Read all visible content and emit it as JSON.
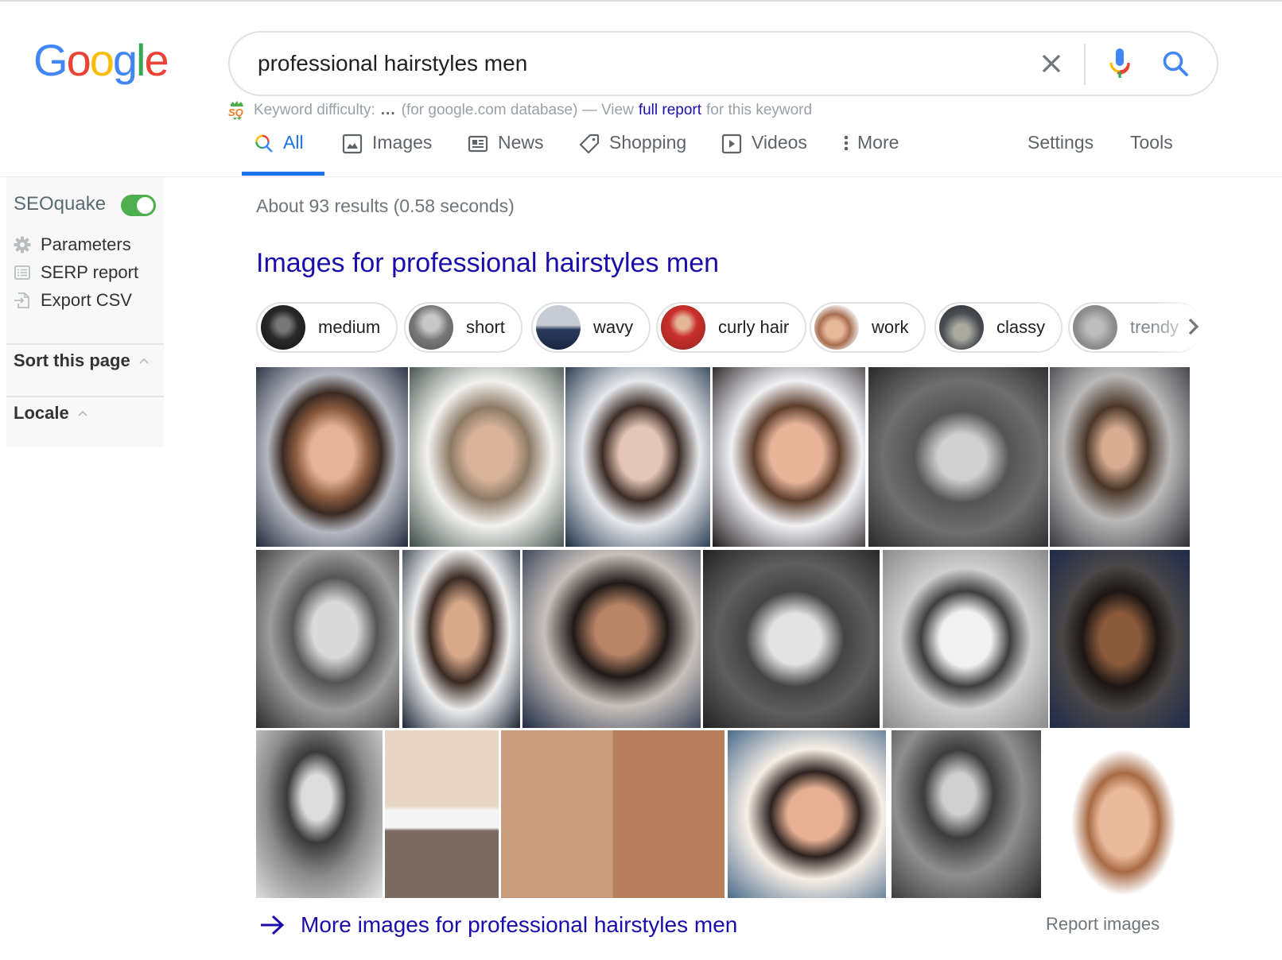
{
  "header": {
    "logo": {
      "letters": [
        "G",
        "o",
        "o",
        "g",
        "l",
        "e"
      ],
      "colors": [
        "#4285f4",
        "#ea4335",
        "#fbbc05",
        "#4285f4",
        "#34a853",
        "#ea4335"
      ]
    },
    "search": {
      "value": "professional hairstyles men",
      "clear_icon": "close-icon",
      "mic_icon": "mic-icon",
      "search_icon": "search-icon"
    },
    "seoquake_bar": {
      "prefix": "Keyword difficulty:",
      "value": "...",
      "middle": "(for google.com database) — View",
      "link": "full report",
      "suffix": "for this keyword"
    },
    "tabs": [
      {
        "label": "All",
        "icon": "search-icon",
        "active": true
      },
      {
        "label": "Images",
        "icon": "image-icon",
        "active": false
      },
      {
        "label": "News",
        "icon": "newspaper-icon",
        "active": false
      },
      {
        "label": "Shopping",
        "icon": "tag-icon",
        "active": false
      },
      {
        "label": "Videos",
        "icon": "play-icon",
        "active": false
      },
      {
        "label": "More",
        "icon": "more-vert-icon",
        "active": false
      }
    ],
    "settings_label": "Settings",
    "tools_label": "Tools",
    "accent": "#1a73e8"
  },
  "sidebar": {
    "title": "SEOquake",
    "toggle_on": true,
    "toggle_color": "#4cae4c",
    "items": [
      {
        "label": "Parameters",
        "icon": "gear-icon"
      },
      {
        "label": "SERP report",
        "icon": "list-icon"
      },
      {
        "label": "Export CSV",
        "icon": "export-icon"
      }
    ],
    "sections": [
      {
        "label": "Sort this page",
        "icon": "chevron-up-icon"
      },
      {
        "label": "Locale",
        "icon": "chevron-up-icon"
      }
    ]
  },
  "main": {
    "result_stats": "About 93 results (0.58 seconds)",
    "images_heading": "Images for professional hairstyles men",
    "link_color": "#1a0dab",
    "chips": [
      {
        "label": "medium"
      },
      {
        "label": "short"
      },
      {
        "label": "wavy"
      },
      {
        "label": "curly hair"
      },
      {
        "label": "work"
      },
      {
        "label": "classy"
      },
      {
        "label": "trendy"
      }
    ],
    "image_rows": [
      {
        "count": 6
      },
      {
        "count": 6
      },
      {
        "count": 6
      }
    ],
    "more_images_label": "More images for professional hairstyles men",
    "report_images_label": "Report images"
  }
}
